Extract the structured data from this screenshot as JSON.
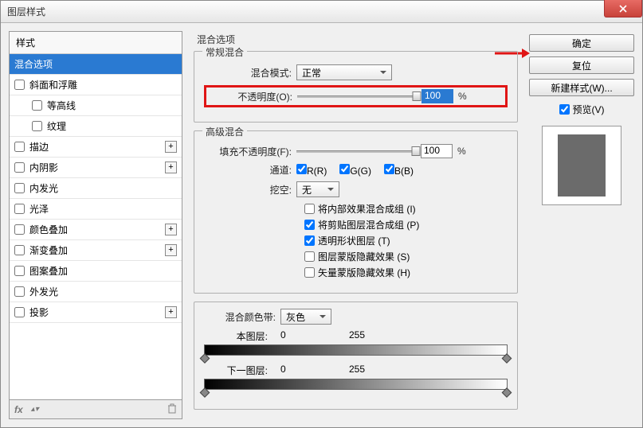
{
  "window": {
    "title": "图层样式"
  },
  "arrow_color": "#e01515",
  "styles": {
    "header": "样式",
    "selected_index": 0,
    "items": [
      {
        "label": "混合选项",
        "checked": null,
        "plus": false,
        "indent": 0
      },
      {
        "label": "斜面和浮雕",
        "checked": false,
        "plus": false,
        "indent": 0
      },
      {
        "label": "等高线",
        "checked": false,
        "plus": false,
        "indent": 1
      },
      {
        "label": "纹理",
        "checked": false,
        "plus": false,
        "indent": 1
      },
      {
        "label": "描边",
        "checked": false,
        "plus": true,
        "indent": 0
      },
      {
        "label": "内阴影",
        "checked": false,
        "plus": true,
        "indent": 0
      },
      {
        "label": "内发光",
        "checked": false,
        "plus": false,
        "indent": 0
      },
      {
        "label": "光泽",
        "checked": false,
        "plus": false,
        "indent": 0
      },
      {
        "label": "颜色叠加",
        "checked": false,
        "plus": true,
        "indent": 0
      },
      {
        "label": "渐变叠加",
        "checked": false,
        "plus": true,
        "indent": 0
      },
      {
        "label": "图案叠加",
        "checked": false,
        "plus": false,
        "indent": 0
      },
      {
        "label": "外发光",
        "checked": false,
        "plus": false,
        "indent": 0
      },
      {
        "label": "投影",
        "checked": false,
        "plus": true,
        "indent": 0
      }
    ],
    "footer_fx": "fx"
  },
  "blending": {
    "section_title": "混合选项",
    "general": {
      "title": "常规混合",
      "mode_label": "混合模式:",
      "mode_value": "正常",
      "opacity_label": "不透明度(O):",
      "opacity_value": "100",
      "opacity_unit": "%"
    },
    "advanced": {
      "title": "高级混合",
      "fill_label": "填充不透明度(F):",
      "fill_value": "100",
      "fill_unit": "%",
      "channels_label": "通道:",
      "channels": {
        "r": "R(R)",
        "g": "G(G)",
        "b": "B(B)"
      },
      "knockout_label": "挖空:",
      "knockout_value": "无",
      "options": [
        {
          "label": "将内部效果混合成组 (I)",
          "checked": false
        },
        {
          "label": "将剪贴图层混合成组 (P)",
          "checked": true
        },
        {
          "label": "透明形状图层 (T)",
          "checked": true
        },
        {
          "label": "图层蒙版隐藏效果 (S)",
          "checked": false
        },
        {
          "label": "矢量蒙版隐藏效果 (H)",
          "checked": false
        }
      ]
    },
    "blendif": {
      "label": "混合颜色带:",
      "value": "灰色",
      "this_layer_label": "本图层:",
      "this_low": "0",
      "this_high": "255",
      "under_layer_label": "下一图层:",
      "under_low": "0",
      "under_high": "255"
    }
  },
  "buttons": {
    "ok": "确定",
    "reset": "复位",
    "new_style": "新建样式(W)...",
    "preview": "预览(V)"
  }
}
